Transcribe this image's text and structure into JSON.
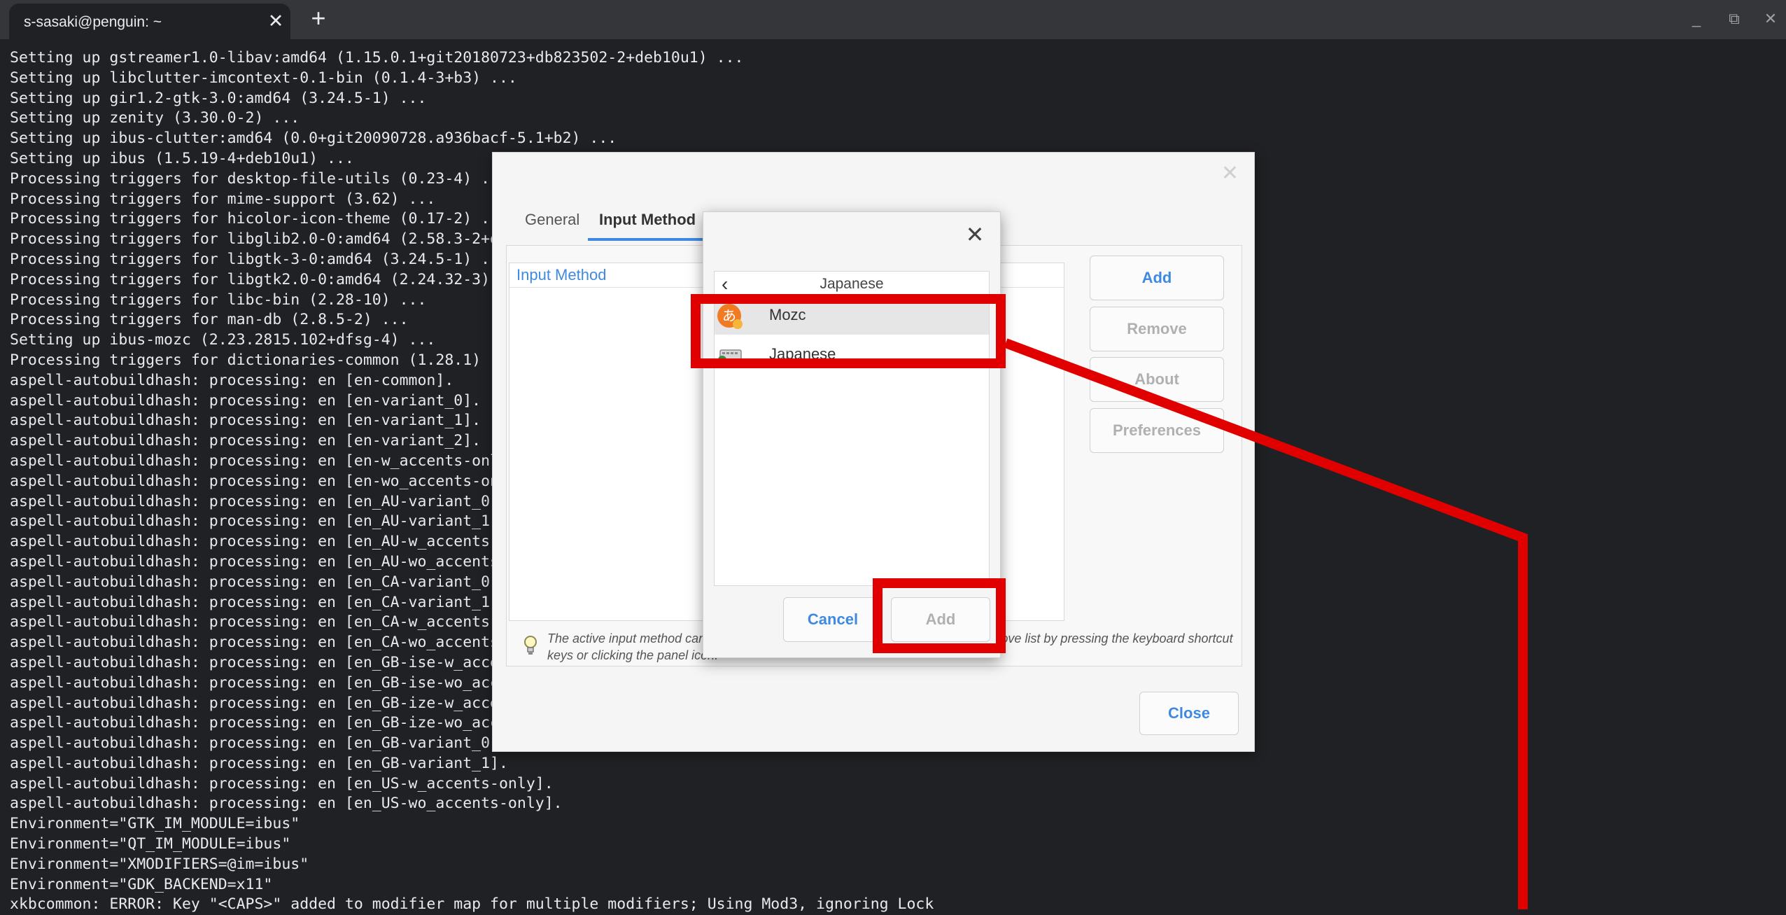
{
  "browser": {
    "tab_title": "s-sasaki@penguin: ~",
    "tab_close": "✕",
    "new_tab": "+",
    "minimize": "_",
    "restore": "⧉",
    "close": "✕"
  },
  "terminal": {
    "lines": [
      "Setting up gstreamer1.0-libav:amd64 (1.15.0.1+git20180723+db823502-2+deb10u1) ...",
      "Setting up libclutter-imcontext-0.1-bin (0.1.4-3+b3) ...",
      "Setting up gir1.2-gtk-3.0:amd64 (3.24.5-1) ...",
      "Setting up zenity (3.30.0-2) ...",
      "Setting up ibus-clutter:amd64 (0.0+git20090728.a936bacf-5.1+b2) ...",
      "Setting up ibus (1.5.19-4+deb10u1) ...",
      "Processing triggers for desktop-file-utils (0.23-4) ...",
      "Processing triggers for mime-support (3.62) ...",
      "Processing triggers for hicolor-icon-theme (0.17-2) ...",
      "Processing triggers for libglib2.0-0:amd64 (2.58.3-2+deb10u2) ...",
      "Processing triggers for libgtk-3-0:amd64 (3.24.5-1) ...",
      "Processing triggers for libgtk2.0-0:amd64 (2.24.32-3) ...",
      "Processing triggers for libc-bin (2.28-10) ...",
      "Processing triggers for man-db (2.8.5-2) ...",
      "Setting up ibus-mozc (2.23.2815.102+dfsg-4) ...",
      "Processing triggers for dictionaries-common (1.28.1) ...",
      "aspell-autobuildhash: processing: en [en-common].",
      "aspell-autobuildhash: processing: en [en-variant_0].",
      "aspell-autobuildhash: processing: en [en-variant_1].",
      "aspell-autobuildhash: processing: en [en-variant_2].",
      "aspell-autobuildhash: processing: en [en-w_accents-only].",
      "aspell-autobuildhash: processing: en [en-wo_accents-only].",
      "aspell-autobuildhash: processing: en [en_AU-variant_0].",
      "aspell-autobuildhash: processing: en [en_AU-variant_1].",
      "aspell-autobuildhash: processing: en [en_AU-w_accents-only].",
      "aspell-autobuildhash: processing: en [en_AU-wo_accents-only].",
      "aspell-autobuildhash: processing: en [en_CA-variant_0].",
      "aspell-autobuildhash: processing: en [en_CA-variant_1].",
      "aspell-autobuildhash: processing: en [en_CA-w_accents-only].",
      "aspell-autobuildhash: processing: en [en_CA-wo_accents-only].",
      "aspell-autobuildhash: processing: en [en_GB-ise-w_accents-only].",
      "aspell-autobuildhash: processing: en [en_GB-ise-wo_accents-only].",
      "aspell-autobuildhash: processing: en [en_GB-ize-w_accents-only].",
      "aspell-autobuildhash: processing: en [en_GB-ize-wo_accents-only].",
      "aspell-autobuildhash: processing: en [en_GB-variant_0].",
      "aspell-autobuildhash: processing: en [en_GB-variant_1].",
      "aspell-autobuildhash: processing: en [en_US-w_accents-only].",
      "aspell-autobuildhash: processing: en [en_US-wo_accents-only].",
      "Environment=\"GTK_IM_MODULE=ibus\"",
      "Environment=\"QT_IM_MODULE=ibus\"",
      "Environment=\"XMODIFIERS=@im=ibus\"",
      "Environment=\"GDK_BACKEND=x11\"",
      "xkbcommon: ERROR: Key \"<CAPS>\" added to modifier map for multiple modifiers; Using Mod3, ignoring Lock"
    ]
  },
  "preferences": {
    "close_icon": "✕",
    "tabs": [
      {
        "label": "General"
      },
      {
        "label": "Input Method"
      }
    ],
    "list_header": "Input Method",
    "buttons": {
      "add": "Add",
      "remove": "Remove",
      "about": "About",
      "preferences": "Preferences"
    },
    "hint": "The active input method can be switched around from the selected ones in the above list by pressing the keyboard shortcut keys or clicking the panel icon.",
    "close_button": "Close"
  },
  "select_dialog": {
    "close_icon": "✕",
    "back_icon": "‹",
    "language": "Japanese",
    "items": [
      {
        "label": "Mozc",
        "icon": "mozc-icon",
        "selected": true
      },
      {
        "label": "Japanese",
        "icon": "keyboard-icon",
        "selected": false
      }
    ],
    "cancel": "Cancel",
    "add": "Add"
  },
  "colors": {
    "annotation": "#e00000",
    "accent": "#3f8ae0",
    "terminal_bg": "#202124"
  }
}
